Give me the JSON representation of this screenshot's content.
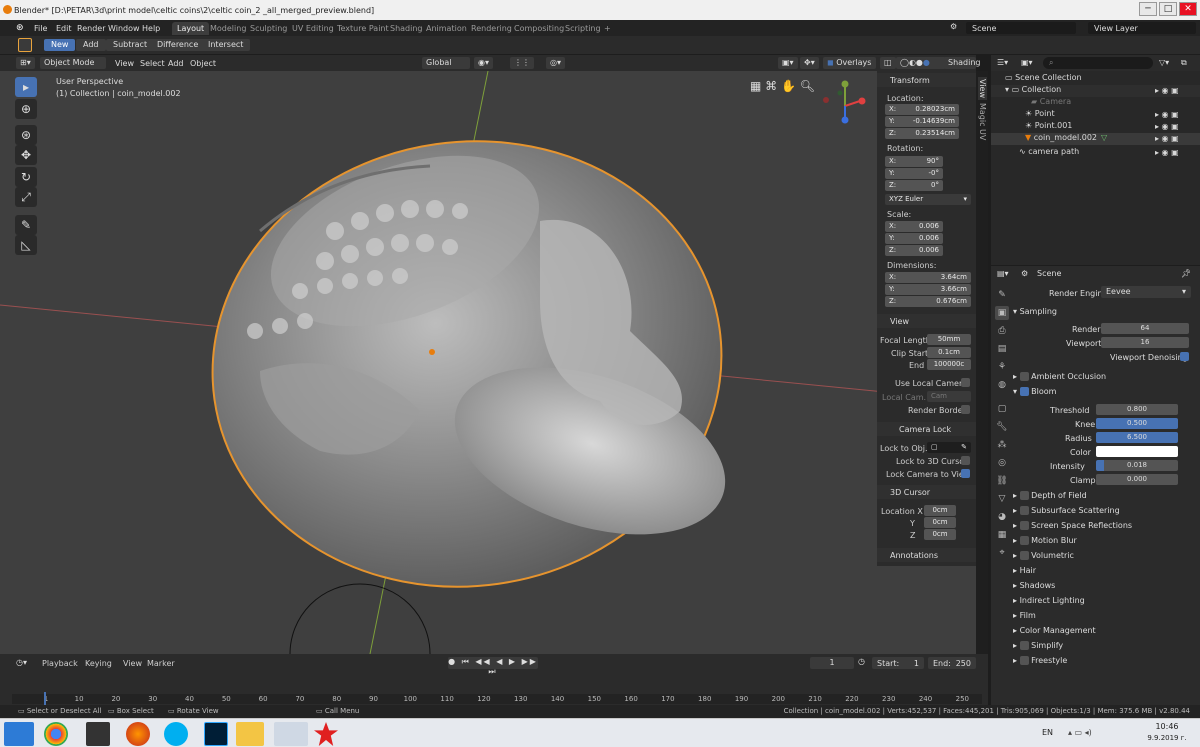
{
  "window": {
    "title": "Blender* [D:\\PETAR\\3d\\print model\\celtic coins\\2\\celtic coin_2 _all_merged_preview.blend]",
    "min": "─",
    "max": "□",
    "close": "✕"
  },
  "menubar": {
    "items": [
      "File",
      "Edit",
      "Render",
      "Window",
      "Help"
    ],
    "workspaces": [
      "Layout",
      "Modeling",
      "Sculpting",
      "UV Editing",
      "Texture Paint",
      "Shading",
      "Animation",
      "Rendering",
      "Compositing",
      "Scripting"
    ],
    "add": "+",
    "scene_label": "Scene",
    "view_layer_label": "View Layer"
  },
  "toolheader": {
    "buttons": [
      "New",
      "Add",
      "Subtract",
      "Difference",
      "Intersect"
    ]
  },
  "viewport_header": {
    "mode": "Object Mode",
    "menus": [
      "View",
      "Select",
      "Add",
      "Object"
    ],
    "orientation": "Global",
    "overlays": "Overlays",
    "shading": "Shading"
  },
  "viewport": {
    "perspective": "User Perspective",
    "collection_line": "(1) Collection | coin_model.002"
  },
  "npanel": {
    "tabs": [
      "View",
      "Magic UV"
    ],
    "transform": {
      "header": "Transform",
      "location_label": "Location:",
      "location": [
        {
          "axis": "X:",
          "value": "0.28023cm"
        },
        {
          "axis": "Y:",
          "value": "-0.14639cm"
        },
        {
          "axis": "Z:",
          "value": "0.23514cm"
        }
      ],
      "rotation_label": "Rotation:",
      "rotation": [
        {
          "axis": "X:",
          "value": "90°"
        },
        {
          "axis": "Y:",
          "value": "-0°"
        },
        {
          "axis": "Z:",
          "value": "0°"
        }
      ],
      "euler": "XYZ Euler",
      "scale_label": "Scale:",
      "scale": [
        {
          "axis": "X:",
          "value": "0.006"
        },
        {
          "axis": "Y:",
          "value": "0.006"
        },
        {
          "axis": "Z:",
          "value": "0.006"
        }
      ],
      "dimensions_label": "Dimensions:",
      "dimensions": [
        {
          "axis": "X:",
          "value": "3.64cm"
        },
        {
          "axis": "Y:",
          "value": "3.66cm"
        },
        {
          "axis": "Z:",
          "value": "0.676cm"
        }
      ]
    },
    "view": {
      "header": "View",
      "focal_label": "Focal Length",
      "focal": "50mm",
      "clip_start_label": "Clip Start",
      "clip_start": "0.1cm",
      "end_label": "End",
      "end": "100000c",
      "use_local_camera": "Use Local Camera",
      "local_cam_label": "Local Cam...",
      "local_cam_value": "Cam",
      "render_border": "Render Border"
    },
    "camera_lock": {
      "header": "Camera Lock",
      "lock_obj": "Lock to Obj...",
      "lock_3d": "Lock to 3D Cursor",
      "lock_cam_view": "Lock Camera to View"
    },
    "cursor": {
      "header": "3D Cursor",
      "loc_x_label": "Location X",
      "y_label": "Y",
      "z_label": "Z",
      "x": "0cm",
      "y": "0cm",
      "z": "0cm"
    },
    "annotations": "Annotations"
  },
  "outliner": {
    "rows": [
      {
        "label": "Scene Collection",
        "indent": 0
      },
      {
        "label": "Collection",
        "indent": 1
      },
      {
        "label": "Camera",
        "indent": 2
      },
      {
        "label": "Point",
        "indent": 2
      },
      {
        "label": "Point.001",
        "indent": 2
      },
      {
        "label": "coin_model.002",
        "indent": 2
      },
      {
        "label": "camera path",
        "indent": 1
      }
    ]
  },
  "properties": {
    "scene": "Scene",
    "render_engine_label": "Render Engine",
    "render_engine": "Eevee",
    "sampling": "Sampling",
    "render_label": "Render",
    "render_value": "64",
    "viewport_label": "Viewport",
    "viewport_value": "16",
    "viewport_denoising": "Viewport Denoising",
    "ambient_occlusion": "Ambient Occlusion",
    "bloom": "Bloom",
    "bloom_fields": [
      {
        "label": "Threshold",
        "value": "0.800",
        "fill": 0.0
      },
      {
        "label": "Knee",
        "value": "0.500",
        "fill": 1.0
      },
      {
        "label": "Radius",
        "value": "6.500",
        "fill": 1.0
      },
      {
        "label": "Color",
        "value": "",
        "fill": 0
      },
      {
        "label": "Intensity",
        "value": "0.018",
        "fill": 0.1
      },
      {
        "label": "Clamp",
        "value": "0.000",
        "fill": 0.0
      }
    ],
    "sections": [
      "Depth of Field",
      "Subsurface Scattering",
      "Screen Space Reflections",
      "Motion Blur",
      "Volumetric",
      "Hair",
      "Shadows",
      "Indirect Lighting",
      "Film",
      "Color Management",
      "Simplify",
      "Freestyle"
    ]
  },
  "timeline": {
    "menus": [
      "Playback",
      "Keying",
      "View",
      "Marker"
    ],
    "current_frame": "1",
    "start_label": "Start:",
    "start": "1",
    "end_label": "End:",
    "end": "250",
    "ticks": [
      "1",
      "10",
      "20",
      "30",
      "40",
      "50",
      "60",
      "70",
      "80",
      "90",
      "100",
      "110",
      "120",
      "130",
      "140",
      "150",
      "160",
      "170",
      "180",
      "190",
      "200",
      "210",
      "220",
      "230",
      "240",
      "250"
    ]
  },
  "statusbar": {
    "left": [
      "Select or Deselect All",
      "Box Select",
      "Rotate View",
      "Call Menu"
    ],
    "right": "Collection | coin_model.002 | Verts:452,537 | Faces:445,201 | Tris:905,069 | Objects:1/3 | Mem: 375.6 MB | v2.80.44"
  },
  "taskbar": {
    "lang": "EN",
    "time": "10:46",
    "date": "9.9.2019 г."
  }
}
